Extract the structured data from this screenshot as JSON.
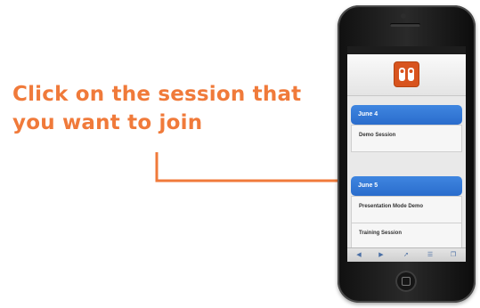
{
  "instruction": {
    "line1": "Click on the session that",
    "line2": "you want to join"
  },
  "colors": {
    "accent": "#f07a3a",
    "group_header": "#2f74d6",
    "logo": "#d8541e"
  },
  "phone": {
    "status_bar": {
      "carrier": "",
      "time": "",
      "battery": ""
    },
    "app_logo_icon": "footprints-icon",
    "session_groups": [
      {
        "date": "June 4",
        "sessions": [
          {
            "title": "Demo Session",
            "subtitle": ""
          }
        ]
      },
      {
        "date": "June 5",
        "sessions": [
          {
            "title": "Presentation Mode Demo",
            "subtitle": ""
          },
          {
            "title": "Training Session",
            "subtitle": ""
          }
        ]
      }
    ],
    "toolbar_icons": [
      "back-icon",
      "forward-icon",
      "share-icon",
      "bookmarks-icon",
      "tabs-icon"
    ]
  }
}
